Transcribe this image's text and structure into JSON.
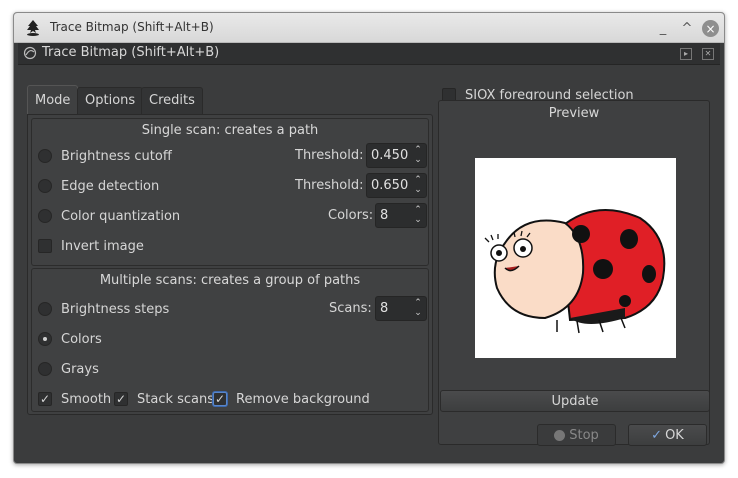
{
  "window": {
    "title": "Trace Bitmap (Shift+Alt+B)",
    "controls": {
      "minimize": "_",
      "maximize": "^",
      "close": "×"
    }
  },
  "dock": {
    "title": "Trace Bitmap (Shift+Alt+B)"
  },
  "tabs": [
    {
      "label": "Mode",
      "active": true
    },
    {
      "label": "Options",
      "active": false
    },
    {
      "label": "Credits",
      "active": false
    }
  ],
  "single_scan": {
    "title": "Single scan: creates a path",
    "brightness_cutoff": {
      "label": "Brightness cutoff",
      "checked": false,
      "param_label": "Threshold:",
      "value": "0.450"
    },
    "edge_detection": {
      "label": "Edge detection",
      "checked": false,
      "param_label": "Threshold:",
      "value": "0.650"
    },
    "color_quantization": {
      "label": "Color quantization",
      "checked": false,
      "param_label": "Colors:",
      "value": "8"
    },
    "invert_image": {
      "label": "Invert image",
      "checked": false
    }
  },
  "multiple_scans": {
    "title": "Multiple scans: creates a group of paths",
    "brightness_steps": {
      "label": "Brightness steps",
      "checked": false,
      "param_label": "Scans:",
      "value": "8"
    },
    "colors": {
      "label": "Colors",
      "checked": true
    },
    "grays": {
      "label": "Grays",
      "checked": false
    },
    "smooth": {
      "label": "Smooth",
      "checked": true
    },
    "stack_scans": {
      "label": "Stack scans",
      "checked": true
    },
    "remove_background": {
      "label": "Remove background",
      "checked": true
    }
  },
  "siox": {
    "label": "SIOX foreground selection",
    "checked": false
  },
  "preview": {
    "title": "Preview",
    "update_label": "Update"
  },
  "actions": {
    "stop_label": "Stop",
    "ok_label": "OK"
  },
  "colors": {
    "ladybug_red": "#e01f26",
    "ladybug_face": "#fadcc7",
    "dialog_bg": "#3b3c3d",
    "focus_blue": "#5a86c8"
  }
}
